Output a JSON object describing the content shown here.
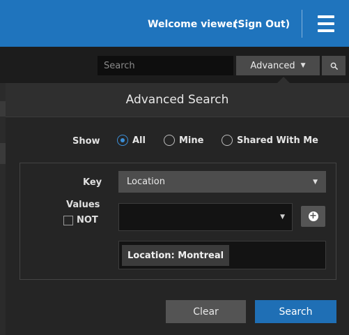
{
  "topbar": {
    "welcome_text": "Welcome viewer",
    "signout_label": "(Sign Out)",
    "menu_icon": "hamburger-menu-icon",
    "color": "#1f74bd"
  },
  "searchbar": {
    "placeholder": "Search",
    "advanced_label": "Advanced",
    "search_icon": "magnifier-icon"
  },
  "advanced_search": {
    "title": "Advanced Search",
    "show_label": "Show",
    "show_options": [
      {
        "label": "All",
        "selected": true
      },
      {
        "label": "Mine",
        "selected": false
      },
      {
        "label": "Shared With Me",
        "selected": false
      }
    ],
    "key_label": "Key",
    "key_value": "Location",
    "values_label": "Values",
    "not_label": "NOT",
    "not_checked": false,
    "values_value": "",
    "tags": [
      "Location: Montreal"
    ],
    "clear_label": "Clear",
    "search_label": "Search",
    "accent_color": "#1f6fb5"
  }
}
